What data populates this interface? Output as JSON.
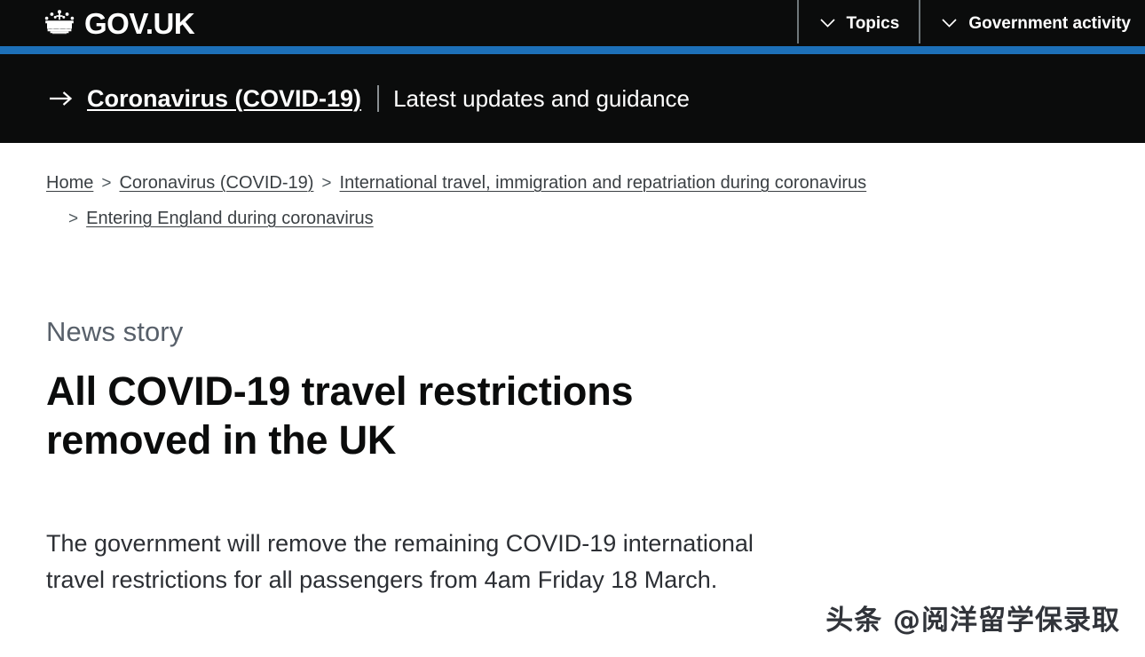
{
  "header": {
    "logo_text": "GOV.UK",
    "crown_icon": "crown-icon",
    "nav": [
      {
        "label": "Topics",
        "icon": "chevron-down-icon"
      },
      {
        "label": "Government activity",
        "icon": "chevron-down-icon"
      }
    ]
  },
  "covid_banner": {
    "arrow_icon": "arrow-right-icon",
    "link_label": "Coronavirus (COVID-19)",
    "divider": "|",
    "subtitle": "Latest updates and guidance"
  },
  "breadcrumbs": {
    "separator": ">",
    "items": [
      {
        "label": "Home"
      },
      {
        "label": "Coronavirus (COVID-19)"
      },
      {
        "label": "International travel, immigration and repatriation during coronavirus"
      },
      {
        "label": "Entering England during coronavirus"
      }
    ]
  },
  "main": {
    "document_type": "News story",
    "title": "All COVID-19 travel restrictions removed in the UK",
    "lede": "The government will remove the remaining COVID-19 international travel restrictions for all passengers from 4am Friday 18 March."
  },
  "watermark": {
    "text": "头条 @阅洋留学保录取"
  },
  "colors": {
    "header_black": "#0b0c0c",
    "accent_blue": "#1d70b8",
    "muted_text": "#505a5f",
    "body_text": "#0b0c0c",
    "page_background": "#ffffff"
  }
}
